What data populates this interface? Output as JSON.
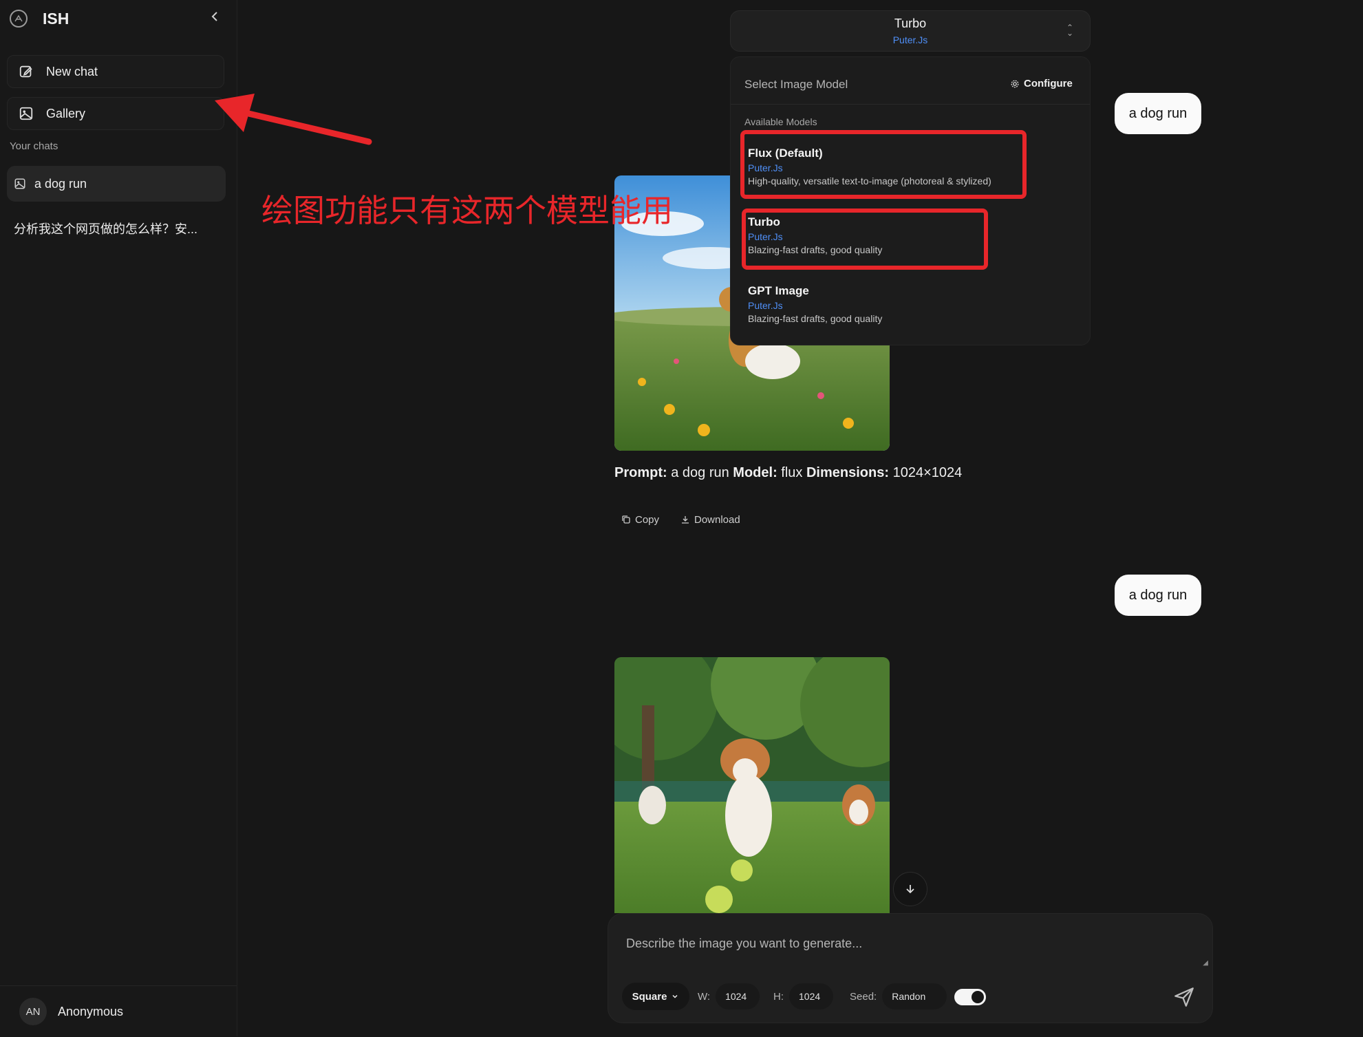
{
  "sidebar": {
    "brand": "ISH",
    "new_chat": "New chat",
    "gallery": "Gallery",
    "section_label": "Your chats",
    "chats": [
      {
        "label": "a dog run"
      },
      {
        "label": "分析我这个网页做的怎么样？安..."
      }
    ],
    "user": {
      "initials": "AN",
      "name": "Anonymous"
    }
  },
  "conversation": {
    "messages": [
      {
        "user_prompt": "a dog run"
      },
      {
        "user_prompt": "a dog run"
      }
    ],
    "result": {
      "prompt_key": "Prompt:",
      "prompt_val": " a dog run ",
      "model_key": "Model:",
      "model_val": " flux ",
      "dims_key": "Dimensions:",
      "dims_val": " 1024×1024"
    },
    "actions": {
      "copy": "Copy",
      "download": "Download"
    }
  },
  "model_selector": {
    "current_name": "Turbo",
    "current_provider": "Puter.Js",
    "title": "Select Image Model",
    "configure": "Configure",
    "section": "Available Models",
    "models": [
      {
        "name": "Flux (Default)",
        "provider": "Puter.Js",
        "desc": "High-quality, versatile text-to-image (photoreal & stylized)"
      },
      {
        "name": "Turbo",
        "provider": "Puter.Js",
        "desc": "Blazing-fast drafts, good quality"
      },
      {
        "name": "GPT Image",
        "provider": "Puter.Js",
        "desc": "Blazing-fast drafts, good quality"
      }
    ]
  },
  "composer": {
    "placeholder": "Describe the image you want to generate...",
    "aspect": "Square",
    "w_label": "W:",
    "w_value": "1024",
    "h_label": "H:",
    "h_value": "1024",
    "seed_label": "Seed:",
    "seed_value": "Randon",
    "toggle_on": true
  },
  "annotation": {
    "text": "绘图功能只有这两个模型能用"
  },
  "colors": {
    "accent_blue": "#4f8ff7",
    "annotation_red": "#e8262a",
    "background": "#171717"
  }
}
